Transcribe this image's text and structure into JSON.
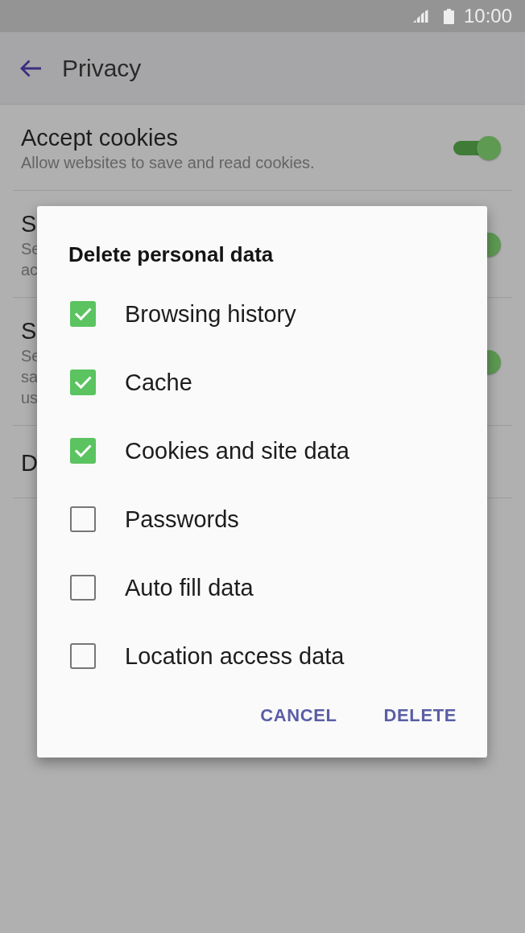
{
  "status_bar": {
    "time": "10:00"
  },
  "app_bar": {
    "title": "Privacy"
  },
  "settings": [
    {
      "kind": "toggle",
      "title": "Accept cookies",
      "subtitle_lines": [
        "Allow websites to save and read cookies."
      ],
      "on": true
    },
    {
      "kind": "toggle",
      "title": "S",
      "subtitle_lines": [
        "Se",
        "ac"
      ],
      "on": true
    },
    {
      "kind": "toggle",
      "title": "S",
      "subtitle_lines": [
        "Se",
        "sa",
        "us"
      ],
      "on": true
    },
    {
      "kind": "plain",
      "title": "D"
    }
  ],
  "dialog": {
    "title": "Delete personal data",
    "options": [
      {
        "label": "Browsing history",
        "checked": true
      },
      {
        "label": "Cache",
        "checked": true
      },
      {
        "label": "Cookies and site data",
        "checked": true
      },
      {
        "label": "Passwords",
        "checked": false
      },
      {
        "label": "Auto fill data",
        "checked": false
      },
      {
        "label": "Location access data",
        "checked": false
      }
    ],
    "buttons": [
      "CANCEL",
      "DELETE"
    ]
  }
}
